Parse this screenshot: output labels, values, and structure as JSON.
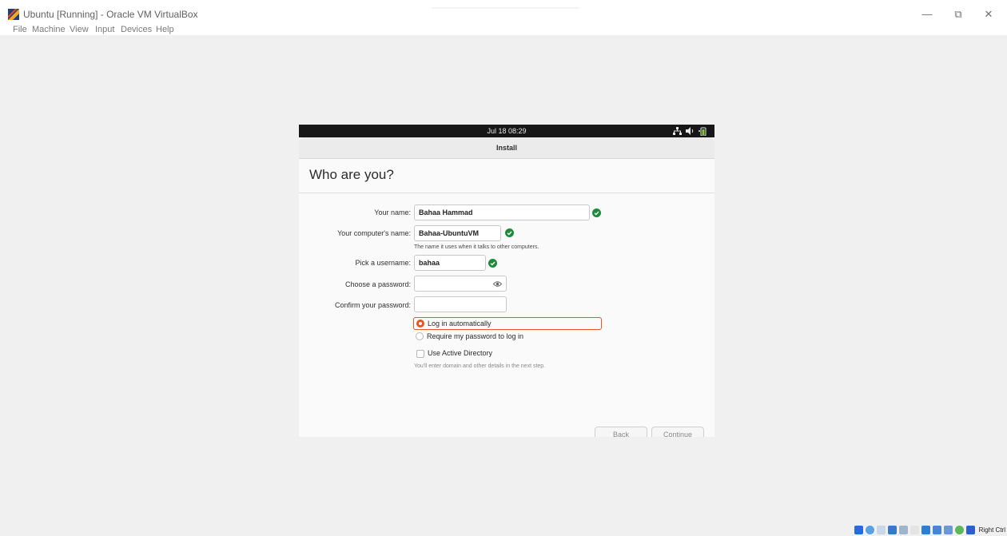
{
  "window": {
    "title": "Ubuntu [Running] - Oracle VM VirtualBox",
    "controls": {
      "minimize": "—",
      "restore": "⧉",
      "close": "✕"
    }
  },
  "menu": [
    "File",
    "Machine",
    "View",
    "Input",
    "Devices",
    "Help"
  ],
  "guest": {
    "clock": "Jul 18  08:29",
    "tray_icons": [
      "network-icon",
      "volume-icon",
      "battery-icon"
    ],
    "header_title": "Install",
    "heading": "Who are you?",
    "form": {
      "name_label": "Your name:",
      "name_value": "Bahaa Hammad",
      "computer_label": "Your computer's name:",
      "computer_value": "Bahaa-UbuntuVM",
      "computer_hint": "The name it uses when it talks to other computers.",
      "username_label": "Pick a username:",
      "username_value": "bahaa",
      "password_label": "Choose a password:",
      "password_value": "",
      "confirm_label": "Confirm your password:",
      "confirm_value": ""
    },
    "login_options": {
      "auto_label": "Log in automatically",
      "require_label": "Require my password to log in",
      "selected": "auto"
    },
    "active_directory": {
      "label": "Use Active Directory",
      "checked": false,
      "hint": "You'll enter domain and other details in the next step."
    },
    "buttons": {
      "back": "Back",
      "continue": "Continue"
    }
  },
  "statusbar": {
    "host_key": "Right Ctrl"
  },
  "colors": {
    "accent": "#e95420",
    "valid_check": "#1e8a3c",
    "topbar": "#171717"
  }
}
